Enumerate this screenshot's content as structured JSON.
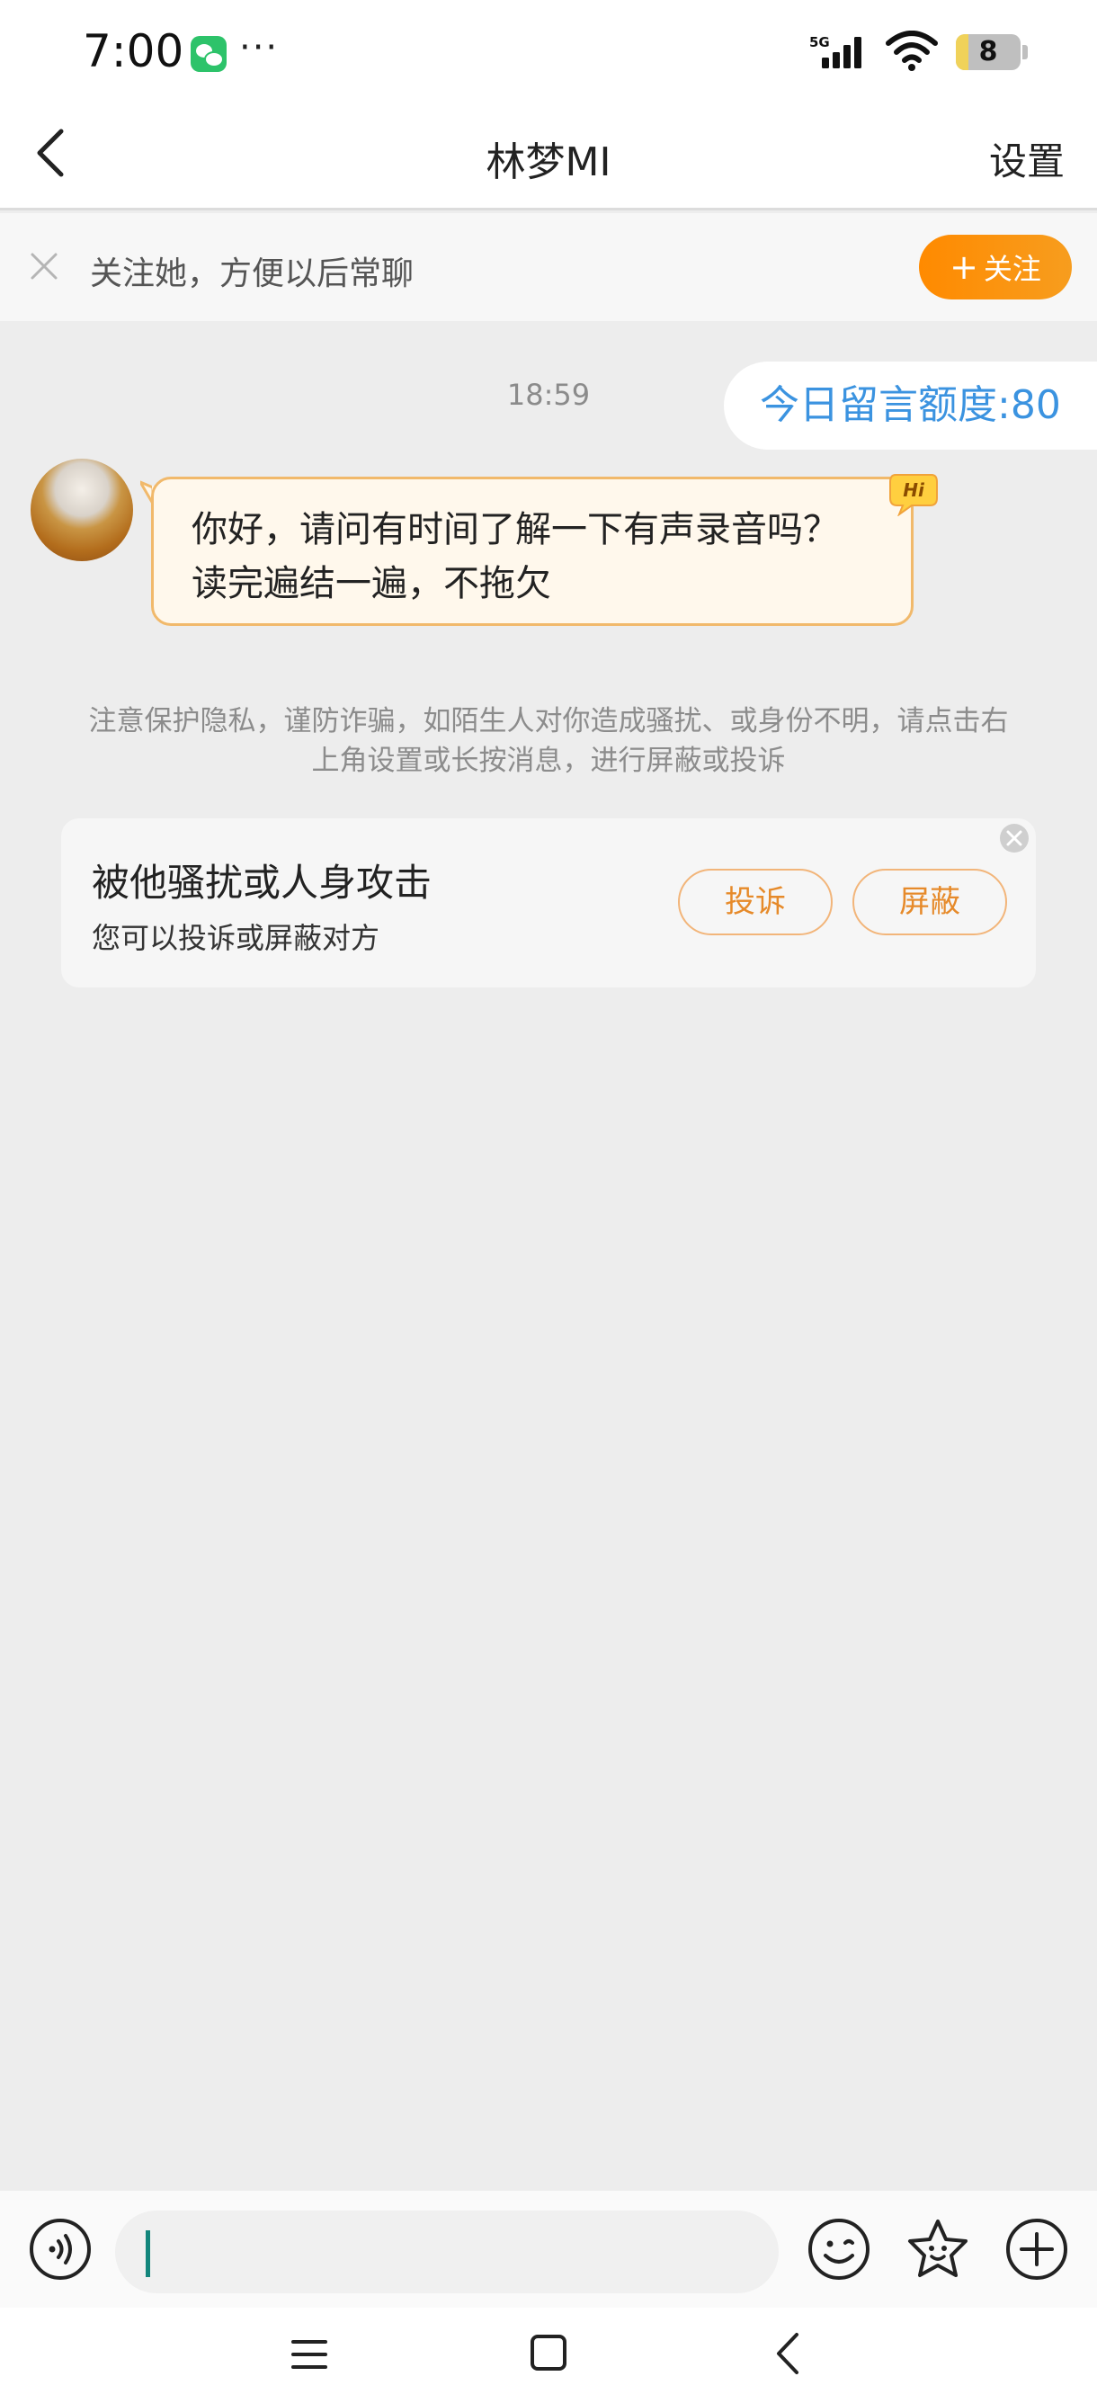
{
  "status_bar": {
    "time": "7:00",
    "more": "···",
    "network": "5G",
    "battery_level": "8",
    "icons": [
      "wechat-icon",
      "signal-icon",
      "wifi-icon",
      "battery-icon"
    ]
  },
  "header": {
    "title": "林梦MI",
    "settings_label": "设置",
    "back_icon": "chevron-left-icon"
  },
  "follow_bar": {
    "text": "关注她，方便以后常聊",
    "button_plus": "+",
    "button_label": "关注",
    "accent_color": "#ff8a00"
  },
  "chat": {
    "timestamp": "18:59",
    "quota_label": "今日留言额度:80",
    "messages": [
      {
        "text": "你好，请问有时间了解一下有声录音吗？读完遍结一遍，不拖欠",
        "badge": "Hi"
      }
    ],
    "notice": "注意保护隐私，谨防诈骗，如陌生人对你造成骚扰、或身份不明，请点击右上角设置或长按消息，进行屏蔽或投诉"
  },
  "report_card": {
    "title": "被他骚扰或人身攻击",
    "subtitle": "您可以投诉或屏蔽对方",
    "report_label": "投诉",
    "block_label": "屏蔽",
    "accent_color": "#e68a2a"
  },
  "input_bar": {
    "value": "",
    "icons": [
      "voice-icon",
      "emoji-icon",
      "sticker-icon",
      "add-icon"
    ]
  },
  "system_nav": {
    "icons": [
      "menu-icon",
      "home-icon",
      "back-icon"
    ]
  },
  "colors": {
    "background": "#ededed",
    "quota_text": "#3b93e0",
    "bubble_bg": "#fff8ec",
    "bubble_border": "#f1b96b"
  }
}
